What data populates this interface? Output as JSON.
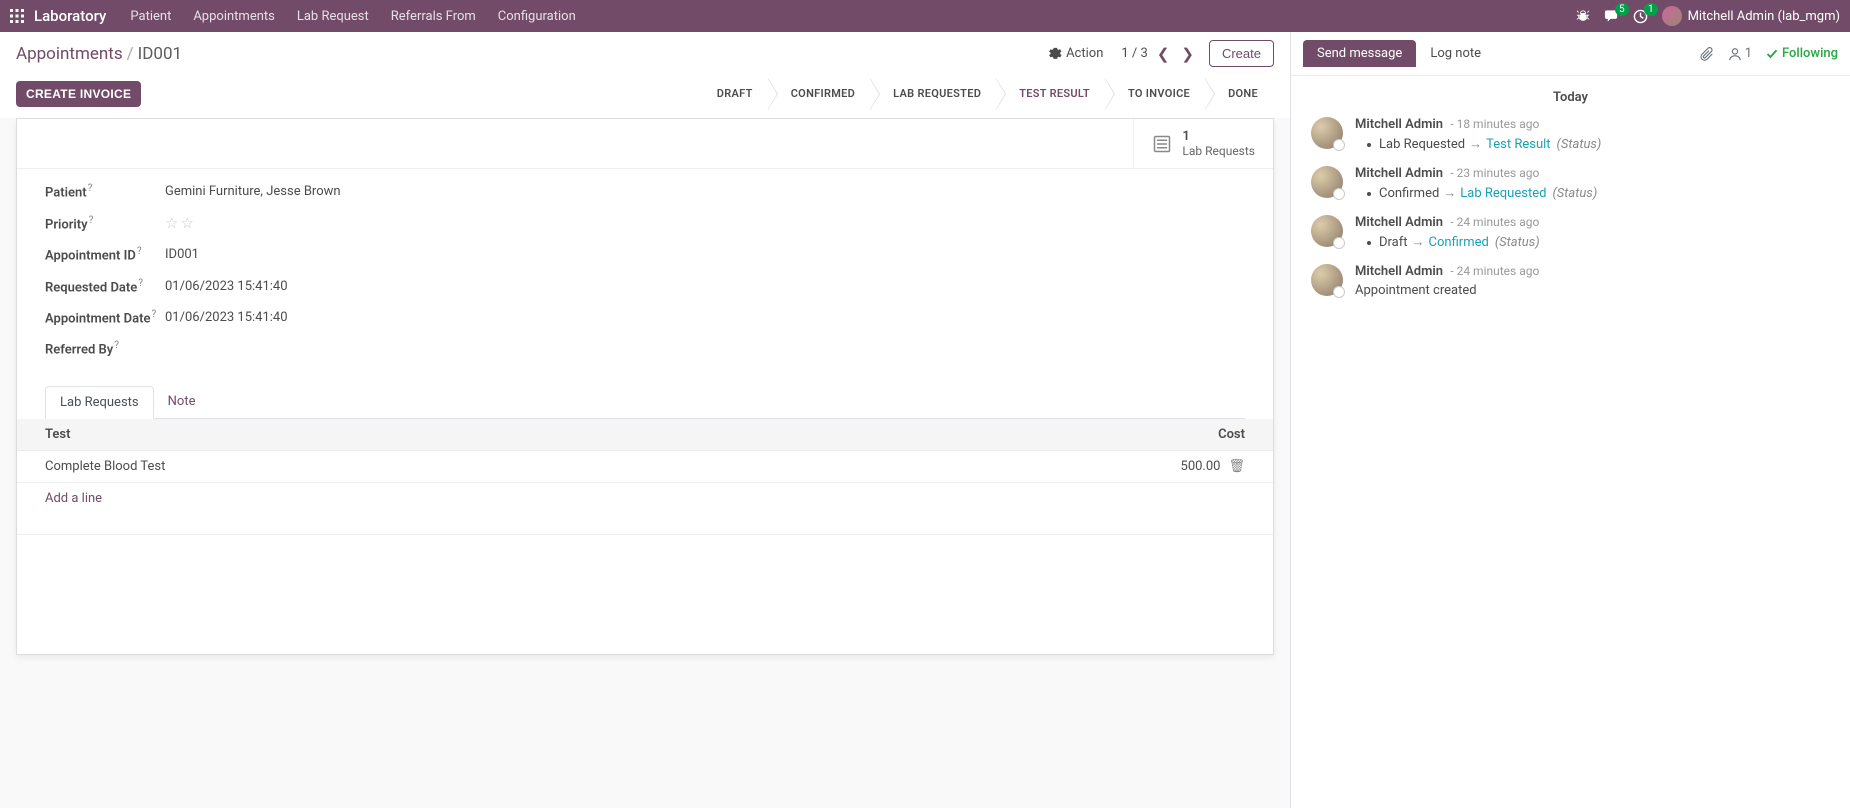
{
  "nav": {
    "brand": "Laboratory",
    "menu": [
      "Patient",
      "Appointments",
      "Lab Request",
      "Referrals From",
      "Configuration"
    ],
    "messages_badge": "5",
    "activities_badge": "1",
    "user_label": "Mitchell Admin (lab_mgm)"
  },
  "control": {
    "breadcrumb_root": "Appointments",
    "breadcrumb_current": "ID001",
    "action_label": "Action",
    "pager": "1 / 3",
    "create_label": "Create"
  },
  "statusbar": {
    "create_invoice": "CREATE INVOICE",
    "steps": [
      "DRAFT",
      "CONFIRMED",
      "LAB REQUESTED",
      "TEST RESULT",
      "TO INVOICE",
      "DONE"
    ],
    "active_index": 3
  },
  "stat_button": {
    "count": "1",
    "label": "Lab Requests"
  },
  "form": {
    "patient_label": "Patient",
    "patient_value": "Gemini Furniture, Jesse Brown",
    "priority_label": "Priority",
    "appt_id_label": "Appointment ID",
    "appt_id_value": "ID001",
    "req_date_label": "Requested Date",
    "req_date_value": "01/06/2023 15:41:40",
    "appt_date_label": "Appointment Date",
    "appt_date_value": "01/06/2023 15:41:40",
    "referred_label": "Referred By",
    "referred_value": ""
  },
  "tabs": {
    "lab_requests": "Lab Requests",
    "note": "Note"
  },
  "table": {
    "col_test": "Test",
    "col_cost": "Cost",
    "rows": [
      {
        "test": "Complete Blood Test",
        "cost": "500.00"
      }
    ],
    "add_line": "Add a line"
  },
  "chatter": {
    "send_message": "Send message",
    "log_note": "Log note",
    "followers_count": "1",
    "follow_label": "Following",
    "date_header": "Today",
    "messages": [
      {
        "author": "Mitchell Admin",
        "time": "- 18 minutes ago",
        "type": "track",
        "old": "Lab Requested",
        "new": "Test Result",
        "field": "(Status)"
      },
      {
        "author": "Mitchell Admin",
        "time": "- 23 minutes ago",
        "type": "track",
        "old": "Confirmed",
        "new": "Lab Requested",
        "field": "(Status)"
      },
      {
        "author": "Mitchell Admin",
        "time": "- 24 minutes ago",
        "type": "track",
        "old": "Draft",
        "new": "Confirmed",
        "field": "(Status)"
      },
      {
        "author": "Mitchell Admin",
        "time": "- 24 minutes ago",
        "type": "body",
        "body": "Appointment created"
      }
    ]
  }
}
